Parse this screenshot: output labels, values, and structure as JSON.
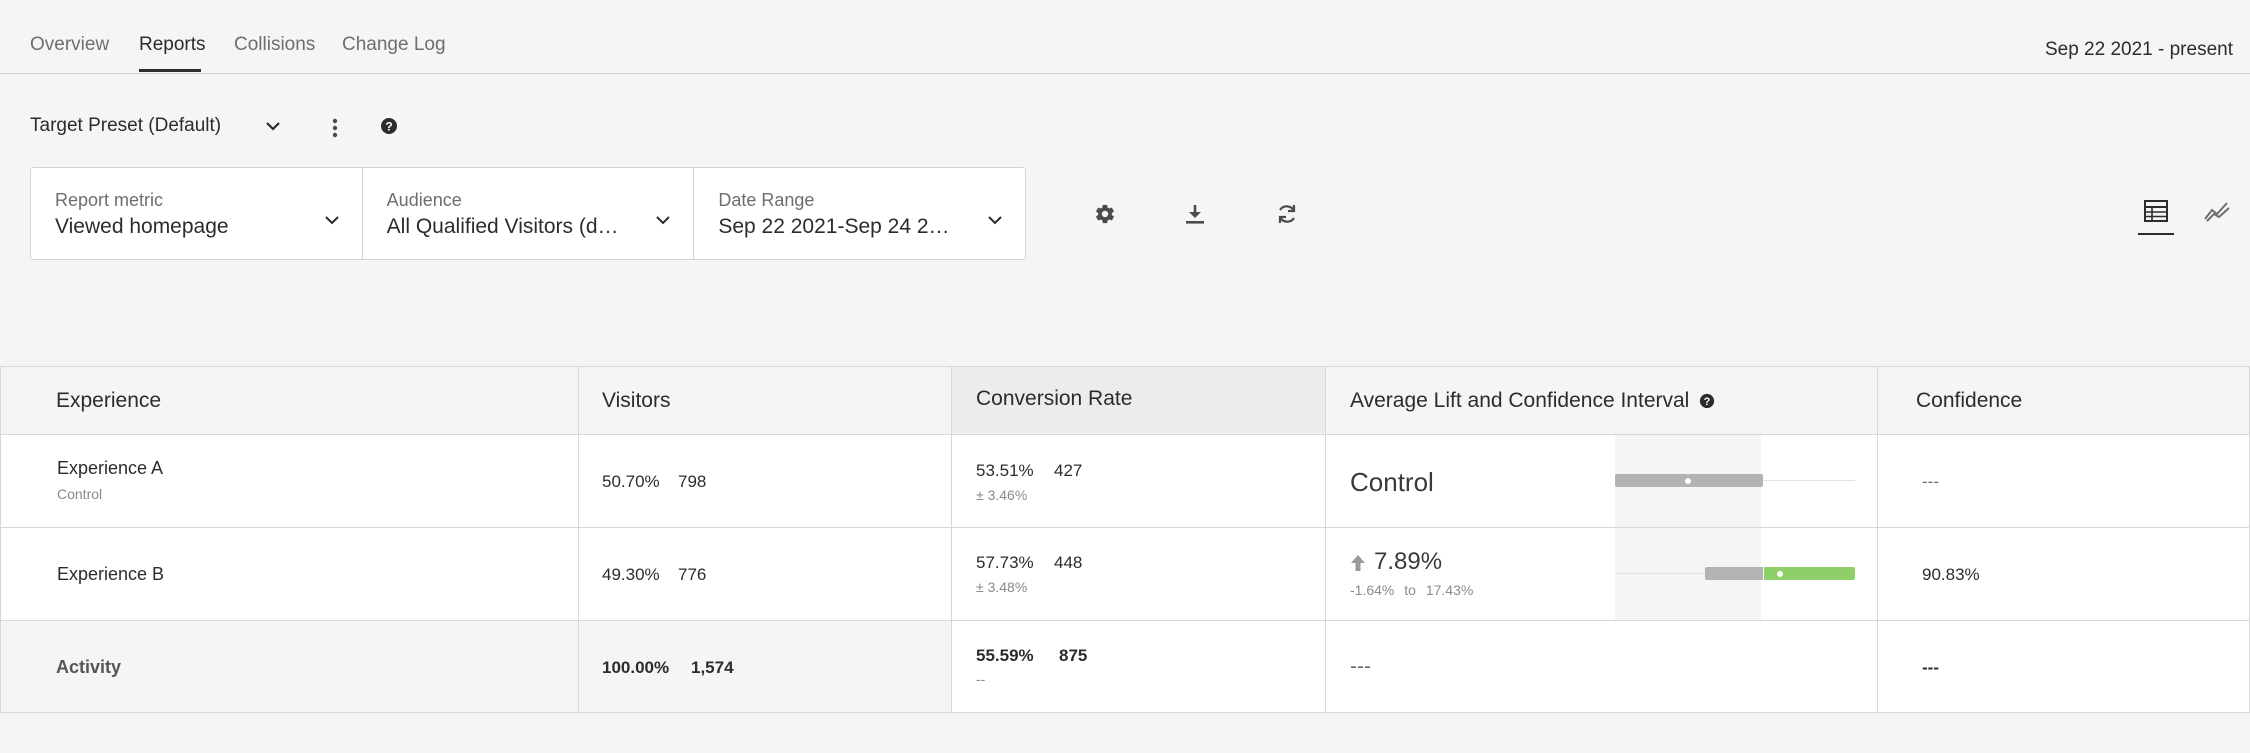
{
  "tabs": [
    {
      "label": "Overview"
    },
    {
      "label": "Reports"
    },
    {
      "label": "Collisions"
    },
    {
      "label": "Change Log"
    }
  ],
  "date_range_header": "Sep 22 2021 - present",
  "preset": {
    "label": "Target Preset (Default)"
  },
  "filters": {
    "report_metric": {
      "label": "Report metric",
      "value": "Viewed homepage"
    },
    "audience": {
      "label": "Audience",
      "value": "All Qualified Visitors (de..."
    },
    "date_range": {
      "label": "Date Range",
      "value": "Sep 22 2021-Sep 24 2021"
    }
  },
  "toolbar_icons": [
    "gear-icon",
    "download-icon",
    "refresh-icon"
  ],
  "view_icons": [
    "table-view-icon",
    "chart-view-icon"
  ],
  "table": {
    "headers": [
      "Experience",
      "Visitors",
      "Conversion Rate",
      "Average Lift and Confidence Interval",
      "Confidence"
    ],
    "rows": [
      {
        "name": "Experience A",
        "sub": "Control",
        "visitors_pct": "50.70%",
        "visitors": "798",
        "conv_rate": "53.51%",
        "conversions": "427",
        "conv_ci": "± 3.46%",
        "lift": "Control",
        "confidence": "---"
      },
      {
        "name": "Experience B",
        "visitors_pct": "49.30%",
        "visitors": "776",
        "conv_rate": "57.73%",
        "conversions": "448",
        "conv_ci": "± 3.48%",
        "lift": "7.89%",
        "lift_low": "-1.64%",
        "lift_to": "to",
        "lift_high": "17.43%",
        "confidence": "90.83%"
      }
    ],
    "total": {
      "name": "Activity",
      "visitors_pct": "100.00%",
      "visitors": "1,574",
      "conv_rate": "55.59%",
      "conversions": "875",
      "conv_ci": "--",
      "lift": "---",
      "confidence": "---"
    }
  },
  "colors": {
    "positive_lift": "#8fcf6a",
    "interval_gray": "#b3b3b3"
  }
}
